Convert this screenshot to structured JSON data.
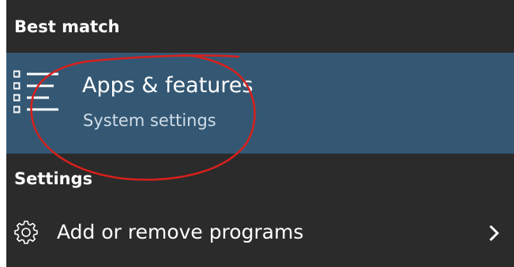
{
  "best_match": {
    "header": "Best match",
    "item": {
      "title": "Apps & features",
      "subtitle": "System settings",
      "icon": "apps-list-icon"
    }
  },
  "settings": {
    "header": "Settings",
    "items": [
      {
        "label": "Add or remove programs",
        "icon": "gear-icon",
        "trailing_icon": "chevron-right-icon"
      }
    ]
  },
  "colors": {
    "panel_background": "#2b2b2b",
    "highlight_background": "#345874",
    "text_primary": "#ffffff",
    "text_secondary": "#d0dce6",
    "annotation_circle": "#d8201c"
  }
}
